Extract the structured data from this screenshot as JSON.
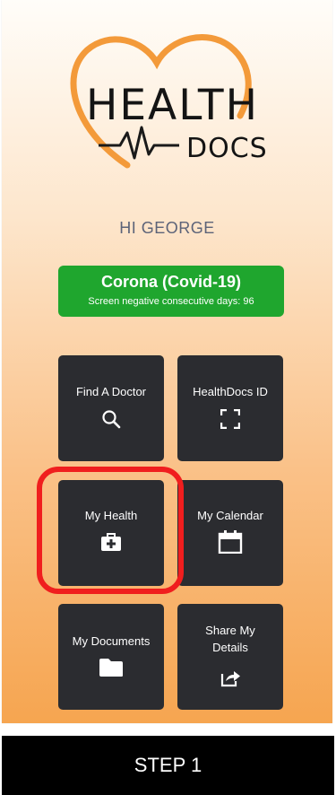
{
  "logo": {
    "word_1": "HEALTH",
    "word_2": "DOCS",
    "accent_color": "#f39a3a"
  },
  "greeting": "HI GEORGE",
  "covid_banner": {
    "title": "Corona (Covid-19)",
    "subtitle": "Screen negative consecutive days: 96",
    "color": "#1fa62e"
  },
  "tiles": [
    {
      "label": "Find A Doctor",
      "icon": "search-icon"
    },
    {
      "label": "HealthDocs ID",
      "icon": "scan-frame-icon"
    },
    {
      "label": "My Health",
      "icon": "medical-bag-icon"
    },
    {
      "label": "My Calendar",
      "icon": "calendar-icon"
    },
    {
      "label": "My Documents",
      "icon": "folder-icon"
    },
    {
      "label": "Share My Details",
      "icon": "share-icon"
    }
  ],
  "highlight": {
    "target": "My Health",
    "color": "#f01e1e"
  },
  "step_banner": "STEP 1"
}
